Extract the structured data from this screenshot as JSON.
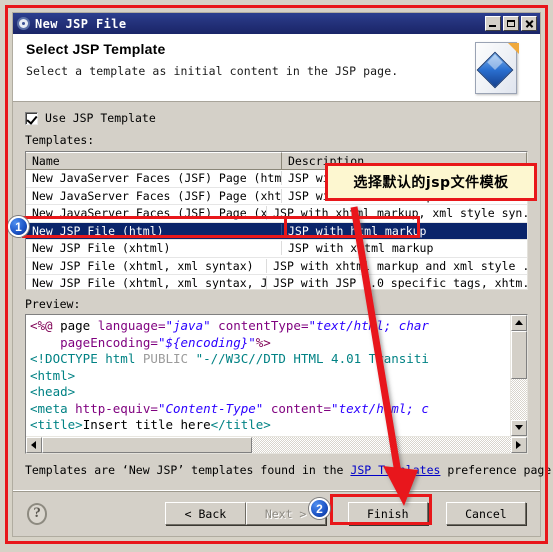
{
  "window": {
    "title": "New JSP File",
    "title_icon": "gear-icon",
    "minimize_label": "_",
    "maximize_label": "□",
    "close_label": "✕"
  },
  "header": {
    "title": "Select JSP Template",
    "description": "Select a template as initial content in the JSP page.",
    "icon": "jsp-page-document-icon"
  },
  "options": {
    "use_template_label": "Use JSP Template",
    "use_template_checked": true,
    "templates_label": "Templates:"
  },
  "table": {
    "columns": [
      "Name",
      "Description"
    ],
    "rows": [
      {
        "name": "New JavaServer Faces (JSF) Page (html)",
        "description": "JSP with html markup",
        "selected": false
      },
      {
        "name": "New JavaServer Faces (JSF) Page (xhtml)",
        "description": "JSP with xhtml markup",
        "selected": false
      },
      {
        "name": "New JavaServer Faces (JSF) Page (xht...",
        "description": "JSP with xhtml markup, xml style syn...",
        "selected": false
      },
      {
        "name": "New JSP File (html)",
        "description": "JSP with html markup",
        "selected": true
      },
      {
        "name": "New JSP File (xhtml)",
        "description": "JSP with xhtml markup",
        "selected": false
      },
      {
        "name": "New JSP File (xhtml, xml syntax)",
        "description": "JSP with xhtml markup and xml style ...",
        "selected": false
      },
      {
        "name": "New JSP File (xhtml, xml syntax, JSP...",
        "description": "JSP with JSP 2.0 specific tags, xhtm...",
        "selected": false
      }
    ]
  },
  "preview": {
    "label": "Preview:",
    "code_lines": [
      [
        {
          "t": "<%@ ",
          "c": "dir"
        },
        {
          "t": "page ",
          "c": "plain"
        },
        {
          "t": "language=",
          "c": "attr"
        },
        {
          "t": "\"java\"",
          "c": "val"
        },
        {
          "t": " contentType=",
          "c": "attr"
        },
        {
          "t": "\"text/html; char",
          "c": "val"
        }
      ],
      [
        {
          "t": "    pageEncoding=",
          "c": "attr"
        },
        {
          "t": "\"${encoding}\"",
          "c": "val"
        },
        {
          "t": "%>",
          "c": "dir"
        }
      ],
      [
        {
          "t": "<!DOCTYPE html ",
          "c": "tag"
        },
        {
          "t": "PUBLIC ",
          "c": "gray"
        },
        {
          "t": "\"-//W3C//DTD HTML 4.01 Transiti",
          "c": "tag"
        }
      ],
      [
        {
          "t": "<html>",
          "c": "tag"
        }
      ],
      [
        {
          "t": "<head>",
          "c": "tag"
        }
      ],
      [
        {
          "t": "<meta ",
          "c": "tag"
        },
        {
          "t": "http-equiv=",
          "c": "attr"
        },
        {
          "t": "\"Content-Type\"",
          "c": "val"
        },
        {
          "t": " content=",
          "c": "attr"
        },
        {
          "t": "\"text/html; c",
          "c": "val"
        }
      ],
      [
        {
          "t": "<title>",
          "c": "tag"
        },
        {
          "t": "Insert title here",
          "c": "text"
        },
        {
          "t": "</title>",
          "c": "tag"
        }
      ]
    ],
    "scroll_up": "▲",
    "scroll_down": "▼",
    "scroll_left": "◀",
    "scroll_right": "▶"
  },
  "footnote": {
    "before": "Templates are ‘New JSP’ templates found in the ",
    "link": "JSP Templates",
    "after": " preference page."
  },
  "buttons": {
    "help": "?",
    "back": "< Back",
    "next": "Next >",
    "next_disabled": true,
    "finish": "Finish",
    "cancel": "Cancel"
  },
  "annotations": {
    "callout_text": "选择默认的jsp文件模板",
    "marker_1": "1",
    "marker_2": "2",
    "accent_color": "#e8171a",
    "marker_color": "#1b52c4",
    "callout_bg": "#fdf7d0"
  }
}
